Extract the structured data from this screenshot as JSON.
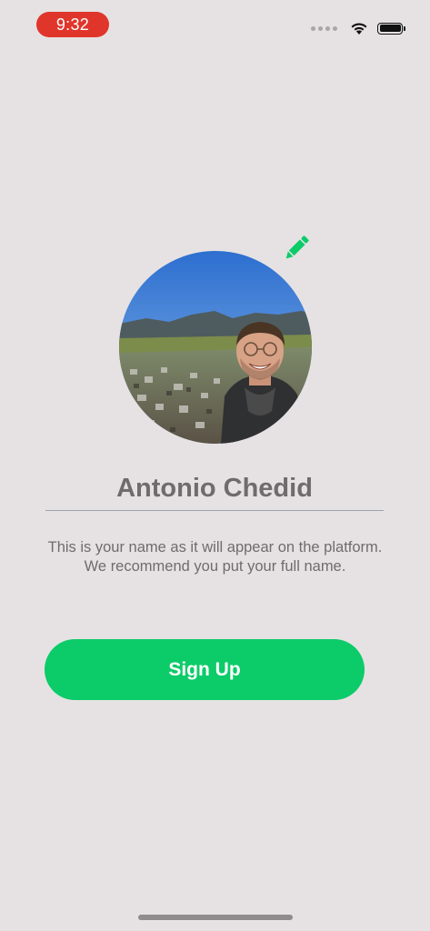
{
  "status_bar": {
    "time": "9:32",
    "icons": [
      "signal-dots-icon",
      "wifi-icon",
      "battery-icon"
    ]
  },
  "profile": {
    "name": "Antonio Chedid",
    "hint_line1": "This is your name as it will appear on the platform.",
    "hint_line2": "We recommend you put your full name.",
    "edit_icon": "pencil-icon"
  },
  "actions": {
    "signup_label": "Sign Up"
  },
  "colors": {
    "background": "#e6e2e3",
    "accent": "#0ccb69",
    "time_pill": "#e0352b",
    "text_muted": "#6f6c6d"
  }
}
